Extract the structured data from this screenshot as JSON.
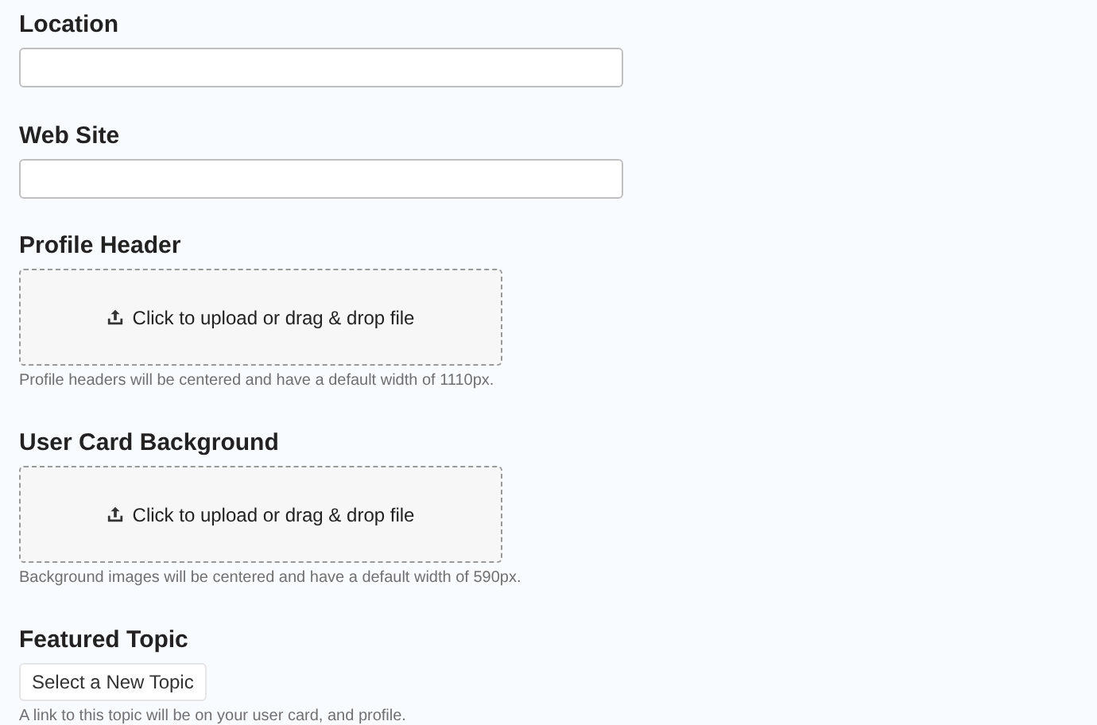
{
  "fields": [
    {
      "kind": "text",
      "label": "Location"
    },
    {
      "kind": "text",
      "label": "Web Site"
    },
    {
      "kind": "upload",
      "label": "Profile Header",
      "prompt": "Click to upload or drag & drop file",
      "hint": "Profile headers will be centered and have a default width of 1110px."
    },
    {
      "kind": "upload",
      "label": "User Card Background",
      "prompt": "Click to upload or drag & drop file",
      "hint": "Background images will be centered and have a default width of 590px."
    },
    {
      "kind": "button",
      "label": "Featured Topic",
      "button": "Select a New Topic",
      "hint": "A link to this topic will be on your user card, and profile."
    }
  ]
}
